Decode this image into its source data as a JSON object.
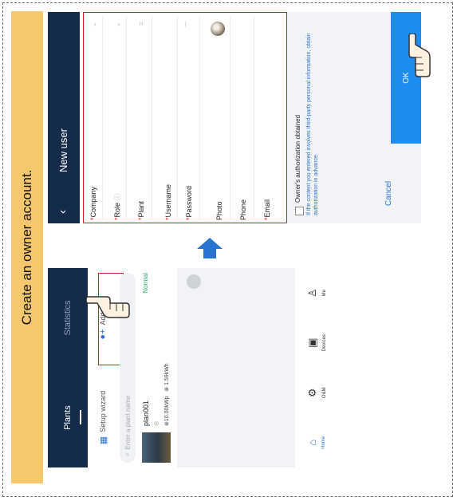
{
  "banner": {
    "text": "Create an owner account."
  },
  "plants_screen": {
    "tabs": [
      {
        "label": "Plants",
        "active": true
      },
      {
        "label": "Statistics",
        "active": false
      }
    ],
    "actions": {
      "setup_wizard": "Setup wizard",
      "add_user": "Add user"
    },
    "search": {
      "placeholder": "Enter a plant name"
    },
    "plant": {
      "name": "plan001",
      "capacity": "10.00kWp",
      "energy": "1.59kWh",
      "status": "Normal"
    },
    "nav": [
      {
        "label": "Home",
        "icon": "home-icon"
      },
      {
        "label": "O&M",
        "icon": "om-icon"
      },
      {
        "label": "Devices",
        "icon": "devices-icon"
      },
      {
        "label": "Me",
        "icon": "person-icon"
      }
    ]
  },
  "new_user_screen": {
    "title": "New user",
    "fields": {
      "company": "Company",
      "role": "Role",
      "plant": "Plant",
      "username": "Username",
      "password": "Password",
      "photo": "Photo",
      "phone": "Phone",
      "email": "Email"
    },
    "owner_authorization": "Owner's authorization obtained",
    "note": "If the content you entered involves third-party personal information, obtain authorization in advance.",
    "cancel": "Cancel",
    "ok": "OK"
  },
  "colors": {
    "banner": "#f6c86d",
    "header": "#142b4a",
    "highlight": "#d61d1d",
    "accent": "#1f8df0",
    "status_normal": "#2fa76a"
  }
}
